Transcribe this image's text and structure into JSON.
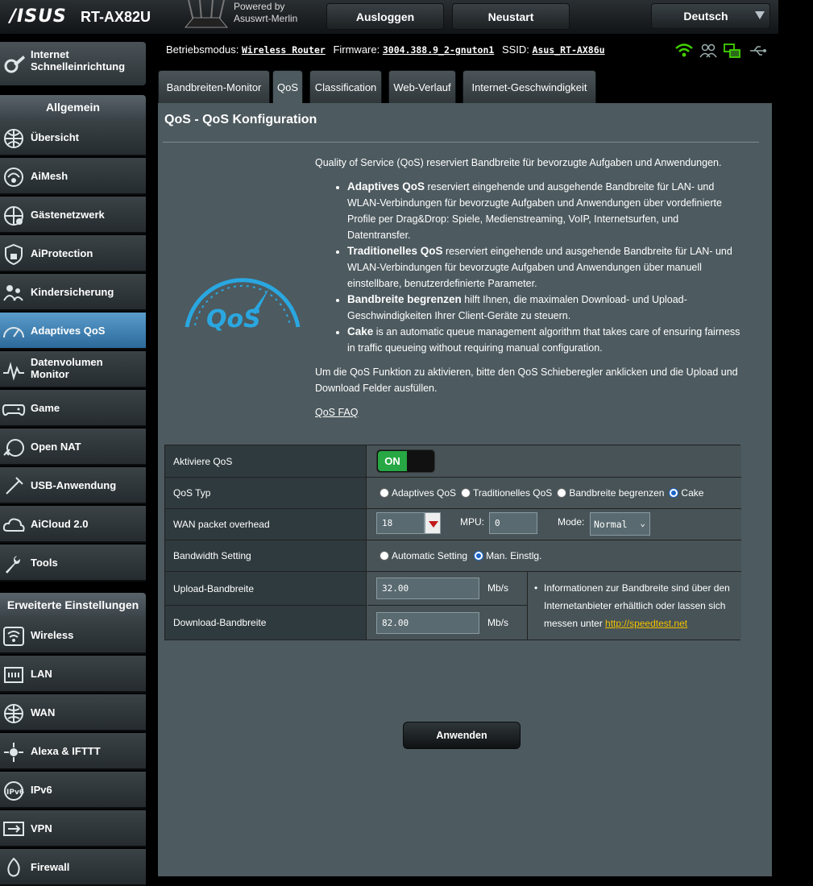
{
  "brand": {
    "logo": "/ISUS",
    "model": "RT-AX82U",
    "powered_line1": "Powered by",
    "powered_line2": "Asuswrt-Merlin"
  },
  "top_buttons": {
    "logout": "Ausloggen",
    "restart": "Neustart",
    "language": "Deutsch"
  },
  "sidebar": {
    "quick_setup_line1": "Internet",
    "quick_setup_line2": "Schnelleinrichtung",
    "general_header": "Allgemein",
    "general_items": [
      {
        "label": "Übersicht",
        "icon": "globe-network-icon"
      },
      {
        "label": "AiMesh",
        "icon": "aimesh-icon"
      },
      {
        "label": "Gästenetzwerk",
        "icon": "guest-network-icon"
      },
      {
        "label": "AiProtection",
        "icon": "lock-shield-icon"
      },
      {
        "label": "Kindersicherung",
        "icon": "parental-control-icon"
      },
      {
        "label": "Adaptives QoS",
        "icon": "speedometer-icon",
        "active": true
      },
      {
        "label_line1": "Datenvolumen",
        "label_line2": "Monitor",
        "icon": "traffic-monitor-icon"
      },
      {
        "label": "Game",
        "icon": "gamepad-icon"
      },
      {
        "label": "Open NAT",
        "icon": "open-nat-icon"
      },
      {
        "label": "USB-Anwendung",
        "icon": "usb-icon"
      },
      {
        "label": "AiCloud 2.0",
        "icon": "cloud-icon"
      },
      {
        "label": "Tools",
        "icon": "wrench-icon"
      }
    ],
    "advanced_header": "Erweiterte Einstellungen",
    "advanced_items": [
      {
        "label": "Wireless",
        "icon": "wireless-icon"
      },
      {
        "label": "LAN",
        "icon": "lan-icon"
      },
      {
        "label": "WAN",
        "icon": "wan-globe-icon"
      },
      {
        "label": "Alexa & IFTTT",
        "icon": "alexa-icon"
      },
      {
        "label": "IPv6",
        "icon": "ipv6-icon"
      },
      {
        "label": "VPN",
        "icon": "vpn-icon"
      },
      {
        "label": "Firewall",
        "icon": "firewall-icon"
      }
    ]
  },
  "status": {
    "mode_label": "Betriebsmodus:",
    "mode_value": "Wireless Router",
    "firmware_label": "Firmware:",
    "firmware_value": "3004.388.9_2-gnuton1",
    "ssid_label": "SSID:",
    "ssid_value": "Asus_RT-AX86u"
  },
  "tabs": [
    "Bandbreiten-Monitor",
    "QoS",
    "Classification",
    "Web-Verlauf",
    "Internet-Geschwindigkeit"
  ],
  "active_tab": "QoS",
  "panel": {
    "title": "QoS - QoS Konfiguration",
    "intro": "Quality of Service (QoS) reserviert Bandbreite für bevorzugte Aufgaben und Anwendungen.",
    "bullets": [
      {
        "bold": "Adaptives QoS",
        "text": " reserviert eingehende und ausgehende Bandbreite für LAN- und WLAN-Verbindungen für bevorzugte Aufgaben und Anwendungen über vordefinierte Profile per Drag&Drop: Spiele, Medienstreaming, VoIP, Internetsurfen, und Datentransfer."
      },
      {
        "bold": "Traditionelles QoS",
        "text": " reserviert eingehende und ausgehende Bandbreite für LAN- und WLAN-Verbindungen für bevorzugte Aufgaben und Anwendungen über manuell einstellbare, benutzerdefinierte Parameter."
      },
      {
        "bold": "Bandbreite begrenzen",
        "text": " hilft Ihnen, die maximalen Download- und Upload-Geschwindigkeiten Ihrer Client-Geräte zu steuern."
      },
      {
        "bold": "Cake",
        "text": " is an automatic queue management algorithm that takes care of ensuring fairness in traffic queueing without requiring manual configuration."
      }
    ],
    "outro": "Um die QoS Funktion zu aktivieren, bitte den QoS Schieberegler anklicken und die Upload und Download Felder ausfüllen.",
    "faq": "QoS FAQ",
    "logo_text": "QoS"
  },
  "settings": {
    "enable_label": "Aktiviere QoS",
    "enable_value": "ON",
    "type_label": "QoS Typ",
    "type_options": [
      "Adaptives QoS",
      "Traditionelles QoS",
      "Bandbreite begrenzen",
      "Cake"
    ],
    "type_selected": "Cake",
    "overhead_label": "WAN packet overhead",
    "overhead_value": "18",
    "mpu_label": "MPU:",
    "mpu_value": "0",
    "mode_label": "Mode:",
    "mode_value": "Normal",
    "bw_label": "Bandwidth Setting",
    "bw_options": [
      "Automatic Setting",
      "Man. Einstlg."
    ],
    "bw_selected": "Man. Einstlg.",
    "upload_label": "Upload-Bandbreite",
    "upload_value": "32.00",
    "download_label": "Download-Bandbreite",
    "download_value": "82.00",
    "unit": "Mb/s",
    "info_text": "Informationen zur Bandbreite sind über den Internetanbieter erhältlich oder lassen sich messen unter ",
    "info_link": "http://speedtest.net"
  },
  "apply": "Anwenden",
  "colors": {
    "accent": "#2b91d6",
    "on": "#27a844",
    "link": "#f3c200",
    "panel": "#4d5a5f",
    "wifi": "#44d100"
  }
}
